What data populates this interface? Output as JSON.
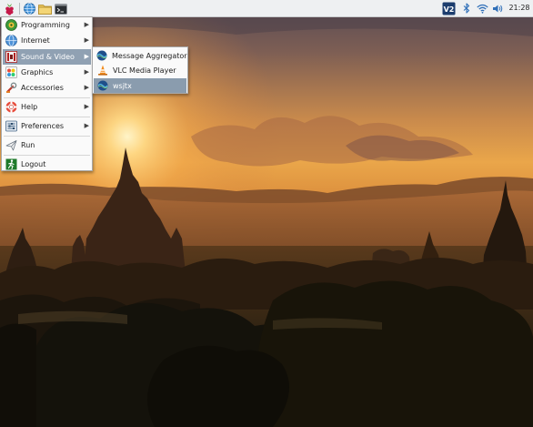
{
  "panel": {
    "clock": "21:28",
    "vnc_label": "V2",
    "icons": [
      "raspberry-menu-icon",
      "web-browser-icon",
      "file-manager-icon",
      "terminal-icon",
      "vnc-icon",
      "bluetooth-icon",
      "wifi-icon",
      "volume-icon"
    ]
  },
  "menu": {
    "items": [
      {
        "label": "Programming",
        "icon": "programming-icon"
      },
      {
        "label": "Internet",
        "icon": "internet-icon"
      },
      {
        "label": "Sound & Video",
        "icon": "sound-video-icon"
      },
      {
        "label": "Graphics",
        "icon": "graphics-icon"
      },
      {
        "label": "Accessories",
        "icon": "accessories-icon"
      },
      {
        "label": "Help",
        "icon": "help-icon"
      },
      {
        "label": "Preferences",
        "icon": "preferences-icon"
      },
      {
        "label": "Run",
        "icon": "run-icon"
      },
      {
        "label": "Logout",
        "icon": "logout-icon"
      }
    ],
    "selected": "Sound & Video"
  },
  "submenu": {
    "items": [
      {
        "label": "Message Aggregator",
        "icon": "message-aggregator-icon"
      },
      {
        "label": "VLC Media Player",
        "icon": "vlc-cone-icon"
      },
      {
        "label": "wsjtx",
        "icon": "wsjtx-icon"
      }
    ],
    "selected": "wsjtx"
  },
  "colors": {
    "selection": "#90a1b3",
    "panel_bg": "#eef0f2",
    "sky_top": "#5a4a52",
    "sun": "#ffd27a"
  }
}
